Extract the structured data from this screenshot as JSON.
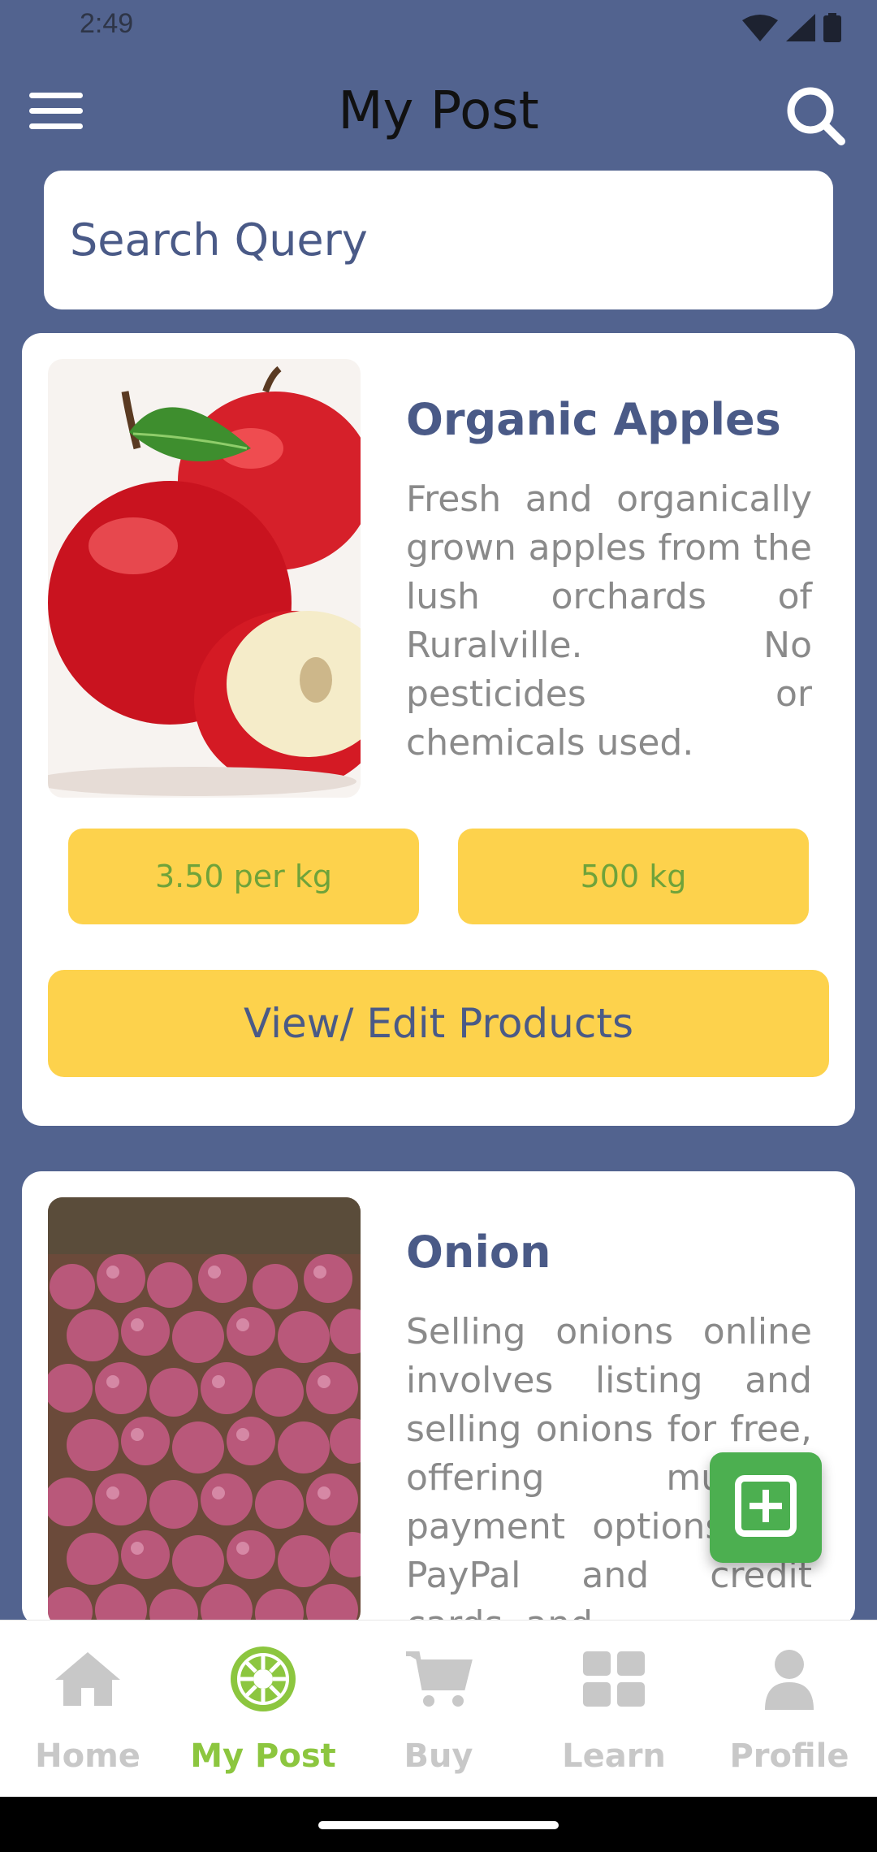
{
  "status_bar": {
    "time": "2:49",
    "icons": [
      "wifi-icon",
      "signal-icon",
      "battery-icon"
    ]
  },
  "app_bar": {
    "title": "My Post",
    "menu_icon": "hamburger-menu-icon",
    "search_icon": "search-icon"
  },
  "search": {
    "placeholder": "Search Query"
  },
  "posts": [
    {
      "title": "Organic Apples",
      "description": "Fresh and organically grown apples from the lush orchards of Ruralville. No pesticides or chemicals used.",
      "price": "3.50 per kg",
      "quantity": "500 kg",
      "edit_label": "View/ Edit Products",
      "image": "red-apples-photo"
    },
    {
      "title": "Onion",
      "description": "Selling onions online involves listing and selling onions for free, offering multiple payment options like PayPal and credit cards, and",
      "image": "red-onions-photo"
    }
  ],
  "fab": {
    "icon": "add-box-icon"
  },
  "bottom_nav": {
    "items": [
      {
        "label": "Home",
        "icon": "home-icon"
      },
      {
        "label": "My Post",
        "icon": "settings-badge-icon"
      },
      {
        "label": "Buy",
        "icon": "cart-icon"
      },
      {
        "label": "Learn",
        "icon": "grid-icon"
      },
      {
        "label": "Profile",
        "icon": "person-icon"
      }
    ]
  },
  "colors": {
    "background": "#52638f",
    "accent_yellow": "#fdd24c",
    "accent_green": "#8cc63f",
    "text_primary": "#4a5a87",
    "fab_green": "#4caf50"
  }
}
